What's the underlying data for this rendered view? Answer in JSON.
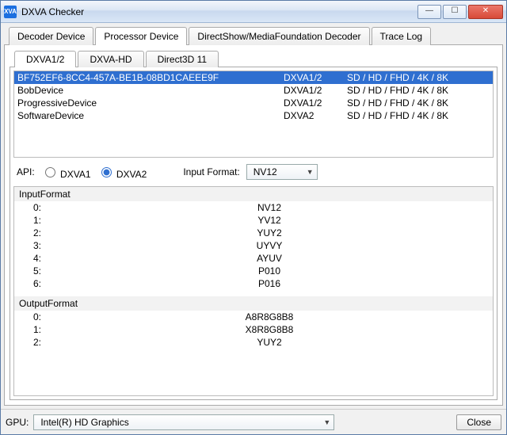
{
  "window": {
    "title": "DXVA Checker",
    "app_icon_text": "XVA"
  },
  "winbuttons": {
    "min": "—",
    "max": "☐",
    "close": "✕"
  },
  "mainTabs": [
    {
      "label": "Decoder Device",
      "active": false
    },
    {
      "label": "Processor Device",
      "active": true
    },
    {
      "label": "DirectShow/MediaFoundation Decoder",
      "active": false
    },
    {
      "label": "Trace Log",
      "active": false
    }
  ],
  "subTabs": [
    {
      "label": "DXVA1/2",
      "active": true
    },
    {
      "label": "DXVA-HD",
      "active": false
    },
    {
      "label": "Direct3D 11",
      "active": false
    }
  ],
  "devices": [
    {
      "name": "BF752EF6-8CC4-457A-BE1B-08BD1CAEEE9F",
      "mode": "DXVA1/2",
      "res": "SD / HD / FHD / 4K / 8K",
      "selected": true
    },
    {
      "name": "BobDevice",
      "mode": "DXVA1/2",
      "res": "SD / HD / FHD / 4K / 8K",
      "selected": false
    },
    {
      "name": "ProgressiveDevice",
      "mode": "DXVA1/2",
      "res": "SD / HD / FHD / 4K / 8K",
      "selected": false
    },
    {
      "name": "SoftwareDevice",
      "mode": "DXVA2",
      "res": "SD / HD / FHD / 4K / 8K",
      "selected": false
    }
  ],
  "api": {
    "label": "API:",
    "options": [
      {
        "label": "DXVA1",
        "checked": false
      },
      {
        "label": "DXVA2",
        "checked": true
      }
    ]
  },
  "inputFormat": {
    "label": "Input Format:",
    "value": "NV12"
  },
  "formatGroups": [
    {
      "title": "InputFormat",
      "rows": [
        {
          "idx": "0:",
          "val": "NV12"
        },
        {
          "idx": "1:",
          "val": "YV12"
        },
        {
          "idx": "2:",
          "val": "YUY2"
        },
        {
          "idx": "3:",
          "val": "UYVY"
        },
        {
          "idx": "4:",
          "val": "AYUV"
        },
        {
          "idx": "5:",
          "val": "P010"
        },
        {
          "idx": "6:",
          "val": "P016"
        }
      ]
    },
    {
      "title": "OutputFormat",
      "rows": [
        {
          "idx": "0:",
          "val": "A8R8G8B8"
        },
        {
          "idx": "1:",
          "val": "X8R8G8B8"
        },
        {
          "idx": "2:",
          "val": "YUY2"
        }
      ]
    }
  ],
  "footer": {
    "gpuLabel": "GPU:",
    "gpuValue": "Intel(R) HD Graphics",
    "closeLabel": "Close"
  }
}
